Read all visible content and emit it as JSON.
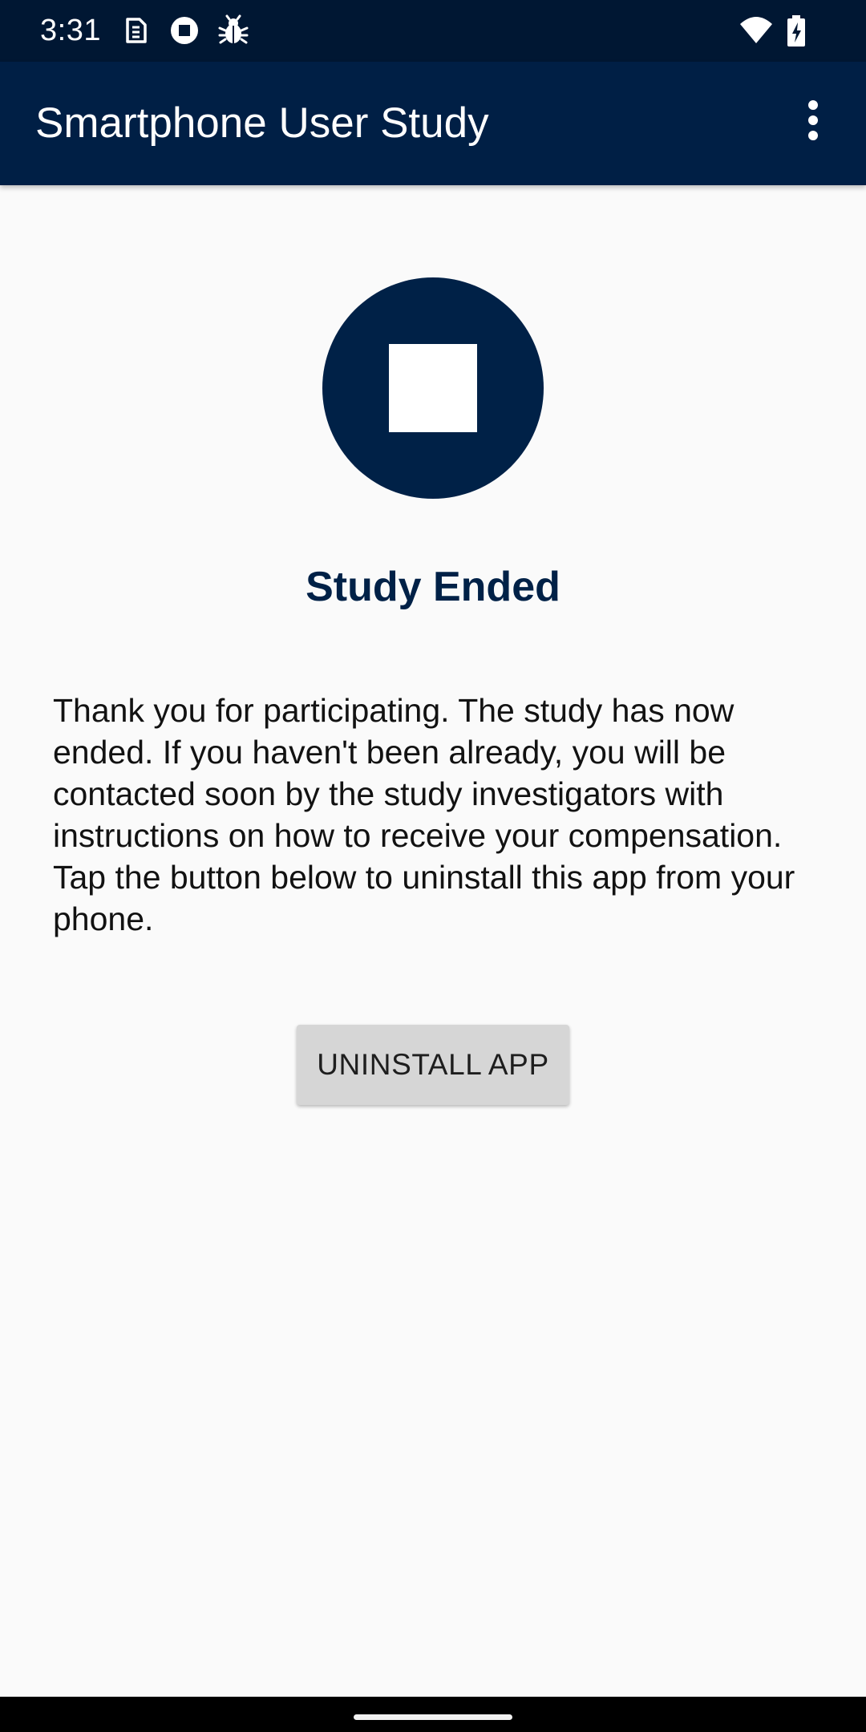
{
  "status_bar": {
    "time": "3:31",
    "left_icons": [
      "sim-icon",
      "stop-notification-icon",
      "bug-icon"
    ],
    "right_icons": [
      "wifi-icon",
      "battery-charging-icon"
    ]
  },
  "app_bar": {
    "title": "Smartphone User Study",
    "menu_icon": "more-vert-icon"
  },
  "main": {
    "hero_icon": "stop-icon",
    "title": "Study Ended",
    "message": "Thank you for participating. The study has now ended. If you haven't been already, you will be contacted soon by the study investigators with instructions on how to receive your compensation. Tap the button below to uninstall this app from your phone.",
    "uninstall_button_label": "UNINSTALL APP"
  },
  "colors": {
    "status_bar_bg": "#001733",
    "app_bar_bg": "#001f45",
    "accent": "#002147",
    "page_bg": "#fafafa",
    "button_bg": "#d6d6d6"
  }
}
